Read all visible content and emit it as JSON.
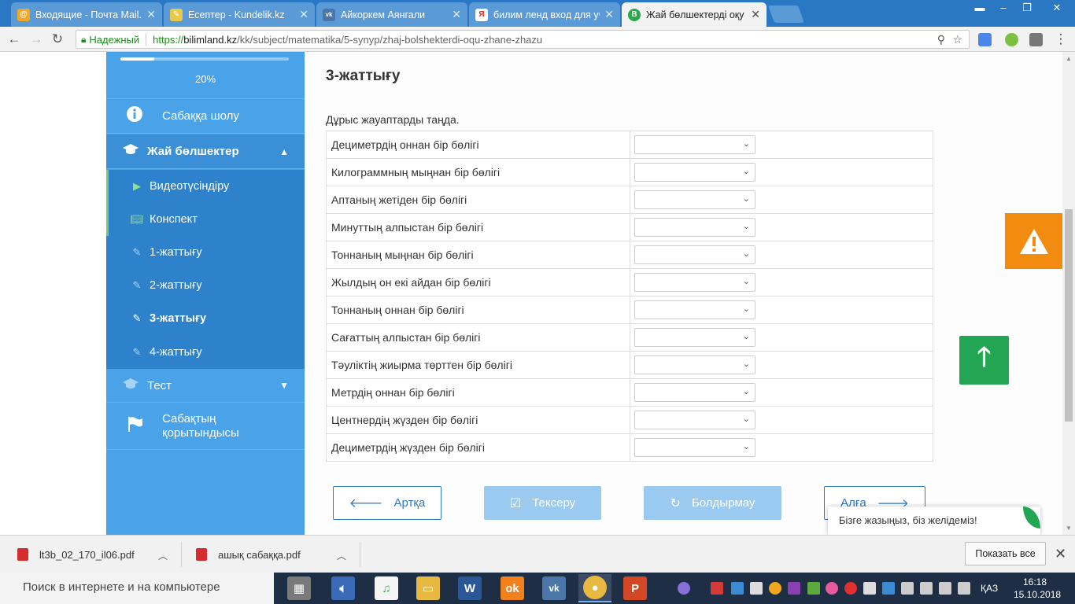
{
  "browser": {
    "tabs": [
      {
        "title": "Входящие - Почта Mail.R",
        "favicon_color": "#f5a623",
        "favicon_glyph": "@"
      },
      {
        "title": "Есептер - Kundelik.kz",
        "favicon_color": "#e8c94a",
        "favicon_glyph": "✎"
      },
      {
        "title": "Айкоркем Аянгали",
        "favicon_color": "#4a76a8",
        "favicon_glyph": "vk"
      },
      {
        "title": "билим ленд вход для уч",
        "favicon_color": "#e52620",
        "favicon_glyph": "Я"
      },
      {
        "title": "Жай бөлшектерді оқу ж",
        "favicon_color": "#2aa84a",
        "favicon_glyph": "B"
      }
    ],
    "secure_label": "Надежный",
    "url_scheme": "https://",
    "url_host": "bilimland.kz",
    "url_path": "/kk/subject/matematika/5-synyp/zhaj-bolshekterdi-oqu-zhane-zhazu"
  },
  "sidebar": {
    "progress_value": 0.2,
    "progress_label": "20%",
    "overview": "Сабаққа шолу",
    "section": "Жай бөлшектер",
    "items": [
      {
        "label": "Видеотүсіндіру",
        "icon": "play-icon"
      },
      {
        "label": "Конспект",
        "icon": "book-icon"
      },
      {
        "label": "1-жаттығу",
        "icon": "edit-icon"
      },
      {
        "label": "2-жаттығу",
        "icon": "edit-icon"
      },
      {
        "label": "3-жаттығу",
        "icon": "edit-icon"
      },
      {
        "label": "4-жаттығу",
        "icon": "edit-icon"
      }
    ],
    "test": "Тест",
    "summary_line1": "Сабақтың",
    "summary_line2": "қорытындысы"
  },
  "content": {
    "title": "3-жаттығу",
    "instruction": "Дұрыс жауаптарды таңда.",
    "questions": [
      "Дециметрдің оннан бір бөлігі",
      "Килограммның мыңнан бір бөлігі",
      "Аптаның жетіден бір бөлігі",
      "Минуттың алпыстан бір бөлігі",
      "Тоннаның мыңнан бір бөлігі",
      "Жылдың он екі айдан бір бөлігі",
      "Тоннаның оннан бір бөлігі",
      "Сағаттың алпыстан бір бөлігі",
      "Тәуліктің жиырма төрттен бір бөлігі",
      "Метрдің оннан бір бөлігі",
      "Центнердің жүзден бір бөлігі",
      "Дециметрдің жүзден бір бөлігі"
    ],
    "buttons": {
      "back": "Артқа",
      "check": "Тексеру",
      "reset": "Болдырмау",
      "next": "Алға"
    },
    "chat_text": "Бізге жазыңыз, біз желідеміз!"
  },
  "downloads": {
    "files": [
      "lt3b_02_170_il06.pdf",
      "ашық сабаққа.pdf"
    ],
    "show_all": "Показать все"
  },
  "taskbar": {
    "search_placeholder": "Поиск в интернете и на компьютере",
    "language": "ҚАЗ",
    "time": "16:18",
    "date": "15.10.2018"
  }
}
